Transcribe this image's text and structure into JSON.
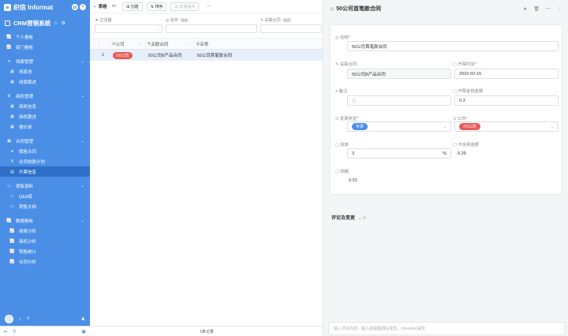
{
  "brand": {
    "name": "织信 Informat"
  },
  "app": {
    "name": "CRM营销系统"
  },
  "sidebar": [
    {
      "label": "个人看板",
      "icon": "chart-icon",
      "type": "item"
    },
    {
      "label": "部门看板",
      "icon": "chart-icon",
      "type": "item"
    },
    {
      "type": "gap"
    },
    {
      "label": "线索管理",
      "icon": "bell-icon",
      "type": "group"
    },
    {
      "label": "线索池",
      "icon": "grid-icon",
      "type": "sub"
    },
    {
      "label": "线索跟进",
      "icon": "grid-icon",
      "type": "sub"
    },
    {
      "type": "gap"
    },
    {
      "label": "商机管理",
      "icon": "gear-icon",
      "type": "group"
    },
    {
      "label": "商机信息",
      "icon": "grid-icon",
      "type": "sub"
    },
    {
      "label": "商机跟进",
      "icon": "grid-icon",
      "type": "sub"
    },
    {
      "label": "报价单",
      "icon": "grid-icon",
      "type": "sub"
    },
    {
      "type": "gap"
    },
    {
      "label": "合同管理",
      "icon": "file-icon",
      "type": "group"
    },
    {
      "label": "销售合同",
      "icon": "dot-icon",
      "type": "sub"
    },
    {
      "label": "合同收款计划",
      "icon": "yen-icon",
      "type": "sub"
    },
    {
      "label": "开票信息",
      "icon": "doc-icon",
      "type": "sub",
      "active": true
    },
    {
      "type": "gap"
    },
    {
      "label": "销售资料",
      "icon": "folder-icon",
      "type": "group"
    },
    {
      "label": "Q&A库",
      "icon": "folder-icon",
      "type": "sub"
    },
    {
      "label": "销售文档",
      "icon": "folder-icon",
      "type": "sub"
    },
    {
      "type": "gap"
    },
    {
      "label": "数据看板",
      "icon": "chart-icon",
      "type": "group"
    },
    {
      "label": "线索分析",
      "icon": "chart-icon",
      "type": "sub"
    },
    {
      "label": "商机分析",
      "icon": "chart-icon",
      "type": "sub"
    },
    {
      "label": "销售统计",
      "icon": "chart-icon",
      "type": "sub"
    },
    {
      "label": "合同分析",
      "icon": "chart-icon",
      "type": "sub"
    }
  ],
  "toolbar": {
    "title": "表格",
    "create": "创建",
    "sort": "排序",
    "batch": "批量操作",
    "more": "···"
  },
  "filters": {
    "filter_label": "过滤器",
    "name_label": "名称",
    "contract_label": "关联合同",
    "tag": "包含"
  },
  "table": {
    "headers": [
      "公司",
      "关联合同",
      "名称"
    ],
    "rows": [
      {
        "index": "1",
        "company": "XX公司",
        "contract": "50公司B产品合同",
        "name": "50公司首笔款合同"
      }
    ],
    "footer": "1条记录"
  },
  "detail": {
    "title": "50公司首笔款合同",
    "fields": {
      "name_label": "名称",
      "name_value": "50公司首笔款合同",
      "contract_label": "关联合同",
      "contract_value": "50公司B产品合同",
      "date_label": "开票时间",
      "date_value": "2022-02-15",
      "remark_label": "备注",
      "remark_placeholder": "无",
      "amount_label": "开票金税金额",
      "amount_value": "0.3",
      "type_label": "发票类型",
      "type_value": "专票",
      "company_label": "公司",
      "company_value": "XX公司",
      "tax_label": "税率",
      "tax_value": "3",
      "tax_unit": "%",
      "notax_label": "不含税金额",
      "notax_value": "0.29",
      "tax_amount_label": "税额",
      "tax_amount_value": "0.01"
    },
    "comments_label": "评论及变更",
    "comments_count": "0",
    "comment_placeholder": "输入评论内容，输入@提醒团队成员，ctrl+enter提交"
  },
  "colors": {
    "sidebar": "#4a8ee6",
    "sidebar_active": "#2f6fc8",
    "badge_red": "#e85a5a",
    "pill_blue": "#4a8ee6"
  }
}
